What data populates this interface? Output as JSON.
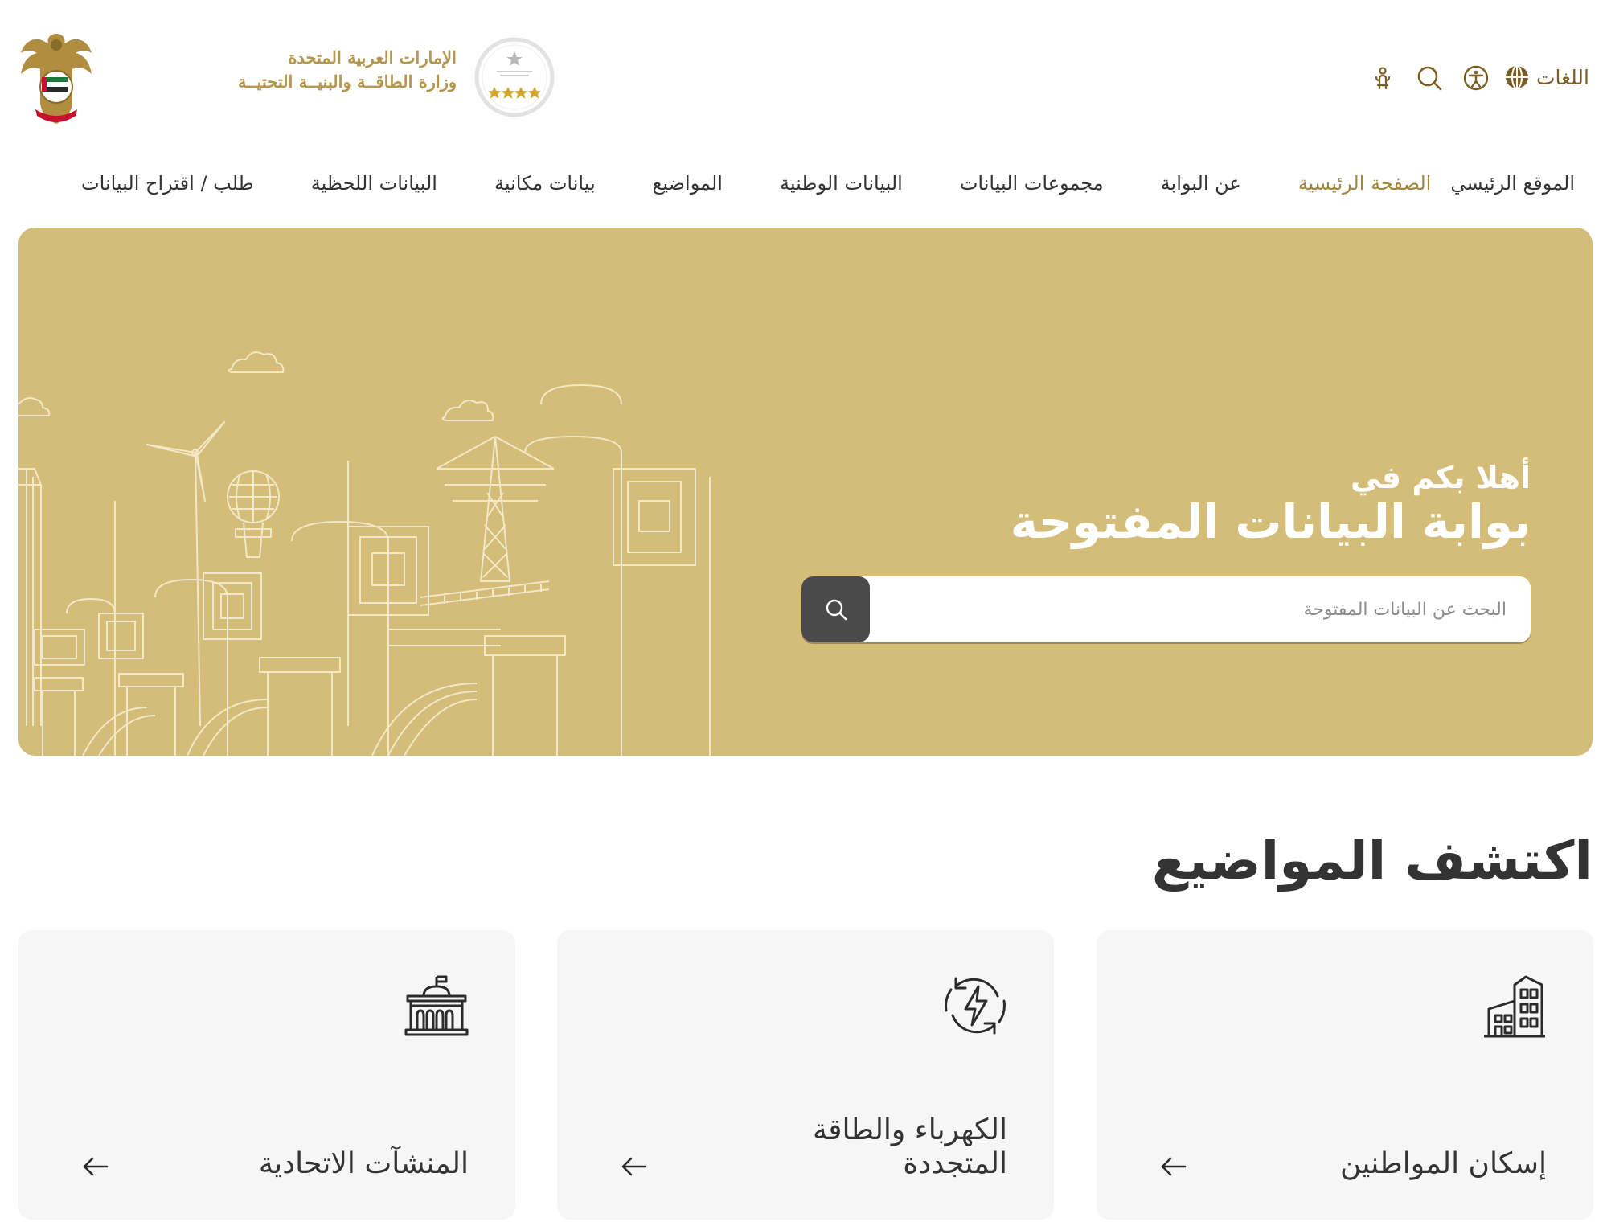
{
  "header": {
    "ministry_line1": "الإمارات العربية المتحدة",
    "ministry_line2": "وزارة الطاقــة والبنيــة التحتيــة",
    "languages_label": "اللغات",
    "icons": [
      "globe-icon",
      "accessibility-icon",
      "search-icon",
      "sign-language-icon"
    ]
  },
  "nav": {
    "items": [
      {
        "label": "الموقع الرئيسي",
        "active": false
      },
      {
        "label": "الصفحة الرئيسية",
        "active": true
      },
      {
        "label": "عن البوابة",
        "active": false
      },
      {
        "label": "مجموعات البيانات",
        "active": false
      },
      {
        "label": "البيانات الوطنية",
        "active": false
      },
      {
        "label": "المواضيع",
        "active": false
      },
      {
        "label": "بيانات مكانية",
        "active": false
      },
      {
        "label": "البيانات اللحظية",
        "active": false
      },
      {
        "label": "طلب / اقتراح البيانات",
        "active": false
      }
    ]
  },
  "hero": {
    "greeting": "أهلا بكم في",
    "title": "بوابة البيانات المفتوحة",
    "search_placeholder": "البحث عن البيانات المفتوحة",
    "background_color": "#d3bd78"
  },
  "topics": {
    "title": "اكتشف المواضيع",
    "cards": [
      {
        "label": "إسكان المواطنين",
        "icon": "buildings-icon"
      },
      {
        "label": "الكهرباء والطاقة المتجددة",
        "icon": "renewable-energy-icon"
      },
      {
        "label": "المنشآت الاتحادية",
        "icon": "federal-building-icon"
      }
    ]
  },
  "colors": {
    "accent_gold": "#a3853d",
    "hero_gold": "#d3bd78",
    "search_button": "#4a4a4a",
    "card_bg": "#f6f6f6"
  }
}
